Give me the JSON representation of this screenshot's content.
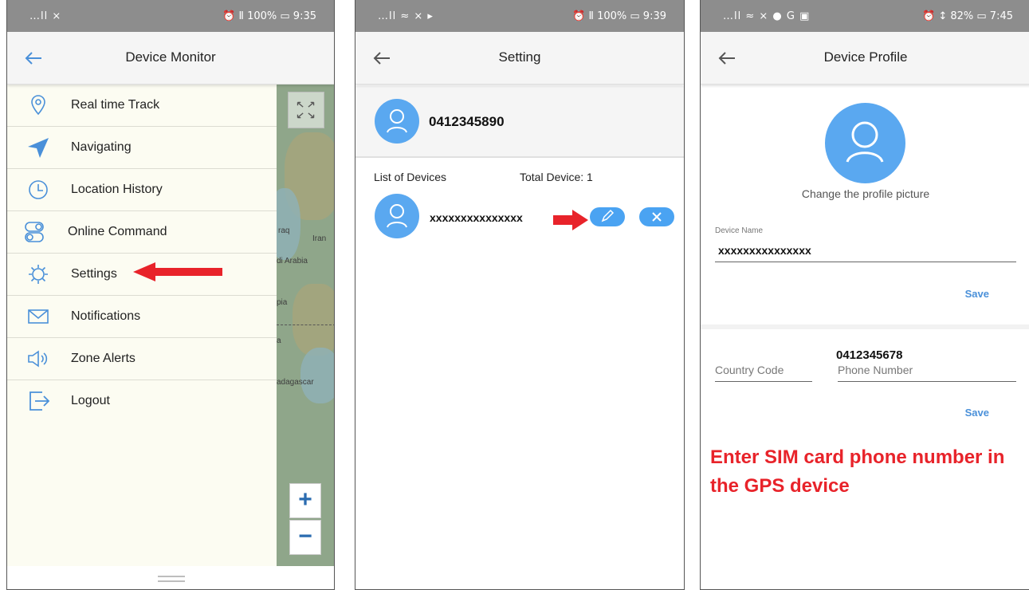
{
  "colors": {
    "accent": "#4aa3f2",
    "annotation_red": "#e8232a",
    "statusbar": "#8d8d8d"
  },
  "panel_monitor": {
    "status_left": "…ll ⨯",
    "status_right": "⏰ Ⅱ 100% ▭ 9:35",
    "title": "Device Monitor",
    "menu": [
      {
        "label": "Real time Track",
        "icon": "location-pin-icon"
      },
      {
        "label": "Navigating",
        "icon": "navigation-arrow-icon"
      },
      {
        "label": "Location History",
        "icon": "clock-icon"
      },
      {
        "label": "Online Command",
        "icon": "toggle-icon"
      },
      {
        "label": "Settings",
        "icon": "gear-icon"
      },
      {
        "label": "Notifications",
        "icon": "envelope-icon"
      },
      {
        "label": "Zone Alerts",
        "icon": "speaker-icon"
      },
      {
        "label": "Logout",
        "icon": "logout-icon"
      }
    ],
    "map_labels": [
      "raq",
      "Iran",
      "di Arabia",
      "pia",
      "a",
      "adagascar"
    ],
    "zoom_in": "+",
    "zoom_out": "−"
  },
  "panel_setting": {
    "status_left": "…ll ≈ ⨯ ▸",
    "status_right": "⏰ Ⅱ 100% ▭ 9:39",
    "title": "Setting",
    "user_phone": "0412345890",
    "list_label": "List of Devices",
    "total_label": "Total Device: 1",
    "device_name": "xxxxxxxxxxxxxxx"
  },
  "panel_profile": {
    "status_left": "…ll ≈ ⨯ ● G ▣",
    "status_right": "⏰ ↕ 82% ▭ 7:45",
    "title": "Device Profile",
    "change_picture": "Change the profile picture",
    "device_name_label": "Device Name",
    "device_name_value": "xxxxxxxxxxxxxxx",
    "save_label": "Save",
    "country_code_placeholder": "Country Code",
    "phone_value": "0412345678",
    "phone_placeholder": "Phone Number",
    "save_label_2": "Save",
    "annotation": "Enter SIM card phone number in the GPS device"
  }
}
